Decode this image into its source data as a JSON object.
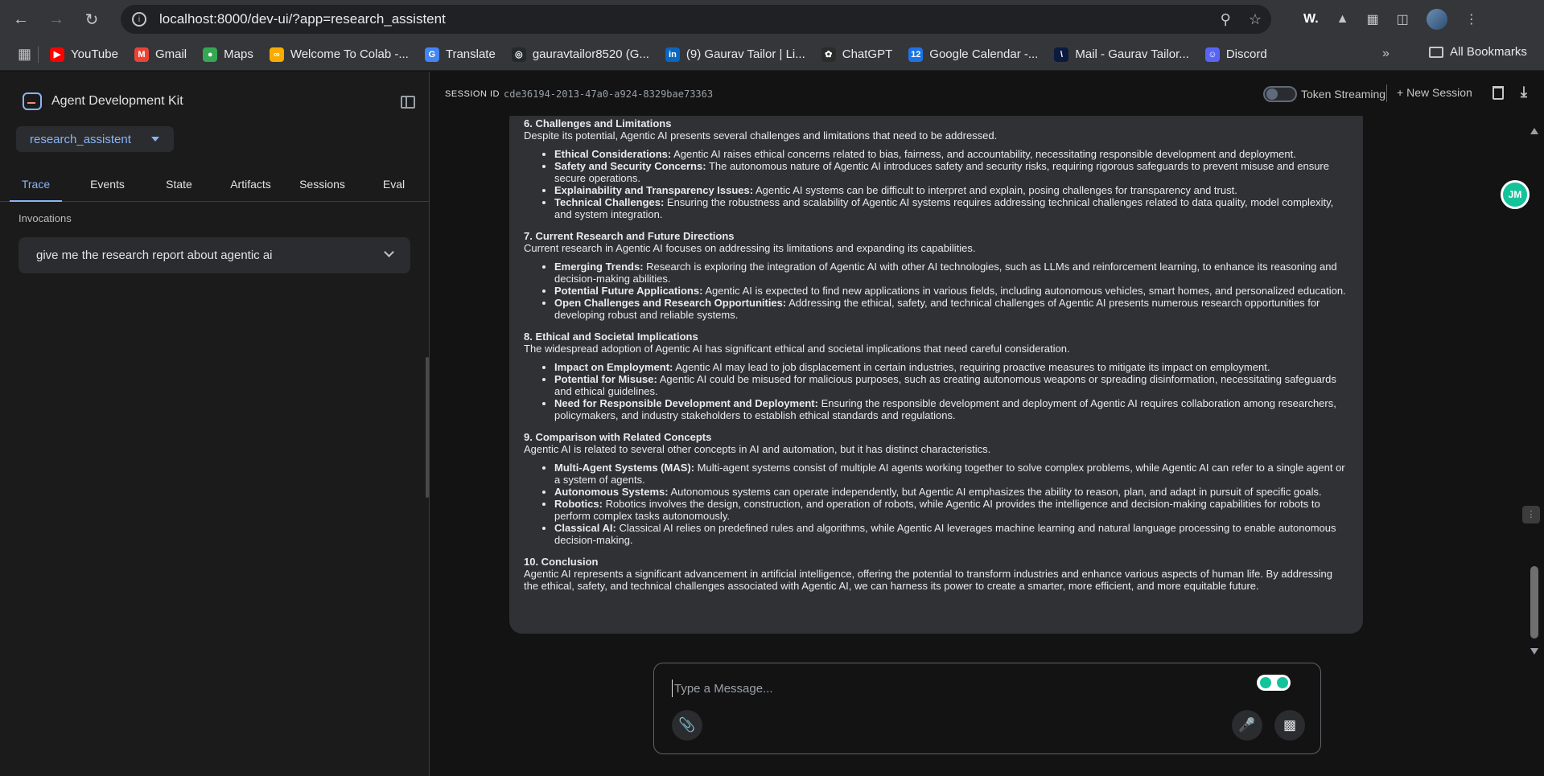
{
  "browser": {
    "url": "localhost:8000/dev-ui/?app=research_assistent",
    "bookmarks": [
      {
        "label": "YouTube",
        "color": "#ff0000",
        "glyph": "▶"
      },
      {
        "label": "Gmail",
        "color": "#ea4335",
        "glyph": "M"
      },
      {
        "label": "Maps",
        "color": "#34a853",
        "glyph": "●"
      },
      {
        "label": "Welcome To Colab -...",
        "color": "#f9ab00",
        "glyph": "∞"
      },
      {
        "label": "Translate",
        "color": "#4285f4",
        "glyph": "G"
      },
      {
        "label": "gauravtailor8520 (G...",
        "color": "#24292e",
        "glyph": "◎"
      },
      {
        "label": "(9) Gaurav Tailor | Li...",
        "color": "#0a66c2",
        "glyph": "in"
      },
      {
        "label": "ChatGPT",
        "color": "#2b2b2b",
        "glyph": "✿"
      },
      {
        "label": "Google Calendar -...",
        "color": "#1a73e8",
        "glyph": "12"
      },
      {
        "label": "Mail - Gaurav Tailor...",
        "color": "#0b1b3f",
        "glyph": "\\"
      },
      {
        "label": "Discord",
        "color": "#5865f2",
        "glyph": "☺"
      }
    ],
    "more_label": "»",
    "all_bookmarks": "All Bookmarks",
    "ext_w": "W."
  },
  "sidebar": {
    "brand": "Agent Development Kit",
    "app_name": "research_assistent",
    "tabs": [
      "Trace",
      "Events",
      "State",
      "Artifacts",
      "Sessions",
      "Eval"
    ],
    "active_tab": "Trace",
    "invocations_label": "Invocations",
    "invocation": "give me the research report about agentic ai"
  },
  "session": {
    "label": "SESSION ID",
    "id": "cde36194-2013-47a0-a924-8329bae73363",
    "token_streaming": "Token Streaming",
    "new_session": "New Session"
  },
  "message": {
    "sections": [
      {
        "heading": "6. Challenges and Limitations",
        "intro": "Despite its potential, Agentic AI presents several challenges and limitations that need to be addressed.",
        "items": [
          {
            "term": "Ethical Considerations:",
            "text": " Agentic AI raises ethical concerns related to bias, fairness, and accountability, necessitating responsible development and deployment."
          },
          {
            "term": "Safety and Security Concerns:",
            "text": " The autonomous nature of Agentic AI introduces safety and security risks, requiring rigorous safeguards to prevent misuse and ensure secure operations."
          },
          {
            "term": "Explainability and Transparency Issues:",
            "text": " Agentic AI systems can be difficult to interpret and explain, posing challenges for transparency and trust."
          },
          {
            "term": "Technical Challenges:",
            "text": " Ensuring the robustness and scalability of Agentic AI systems requires addressing technical challenges related to data quality, model complexity, and system integration."
          }
        ]
      },
      {
        "heading": "7. Current Research and Future Directions",
        "intro": "Current research in Agentic AI focuses on addressing its limitations and expanding its capabilities.",
        "items": [
          {
            "term": "Emerging Trends:",
            "text": " Research is exploring the integration of Agentic AI with other AI technologies, such as LLMs and reinforcement learning, to enhance its reasoning and decision-making abilities."
          },
          {
            "term": "Potential Future Applications:",
            "text": " Agentic AI is expected to find new applications in various fields, including autonomous vehicles, smart homes, and personalized education."
          },
          {
            "term": "Open Challenges and Research Opportunities:",
            "text": " Addressing the ethical, safety, and technical challenges of Agentic AI presents numerous research opportunities for developing robust and reliable systems."
          }
        ]
      },
      {
        "heading": "8. Ethical and Societal Implications",
        "intro": "The widespread adoption of Agentic AI has significant ethical and societal implications that need careful consideration.",
        "items": [
          {
            "term": "Impact on Employment:",
            "text": " Agentic AI may lead to job displacement in certain industries, requiring proactive measures to mitigate its impact on employment."
          },
          {
            "term": "Potential for Misuse:",
            "text": " Agentic AI could be misused for malicious purposes, such as creating autonomous weapons or spreading disinformation, necessitating safeguards and ethical guidelines."
          },
          {
            "term": "Need for Responsible Development and Deployment:",
            "text": " Ensuring the responsible development and deployment of Agentic AI requires collaboration among researchers, policymakers, and industry stakeholders to establish ethical standards and regulations."
          }
        ]
      },
      {
        "heading": "9. Comparison with Related Concepts",
        "intro": "Agentic AI is related to several other concepts in AI and automation, but it has distinct characteristics.",
        "items": [
          {
            "term": "Multi-Agent Systems (MAS):",
            "text": " Multi-agent systems consist of multiple AI agents working together to solve complex problems, while Agentic AI can refer to a single agent or a system of agents."
          },
          {
            "term": "Autonomous Systems:",
            "text": " Autonomous systems can operate independently, but Agentic AI emphasizes the ability to reason, plan, and adapt in pursuit of specific goals."
          },
          {
            "term": "Robotics:",
            "text": " Robotics involves the design, construction, and operation of robots, while Agentic AI provides the intelligence and decision-making capabilities for robots to perform complex tasks autonomously."
          },
          {
            "term": "Classical AI:",
            "text": " Classical AI relies on predefined rules and algorithms, while Agentic AI leverages machine learning and natural language processing to enable autonomous decision-making."
          }
        ]
      },
      {
        "heading": "10. Conclusion",
        "intro": "Agentic AI represents a significant advancement in artificial intelligence, offering the potential to transform industries and enhance various aspects of human life. By addressing the ethical, safety, and technical challenges associated with Agentic AI, we can harness its power to create a smarter, more efficient, and more equitable future.",
        "items": []
      }
    ]
  },
  "composer": {
    "placeholder": "Type a Message..."
  },
  "grammarly": {
    "initials": "JM"
  }
}
